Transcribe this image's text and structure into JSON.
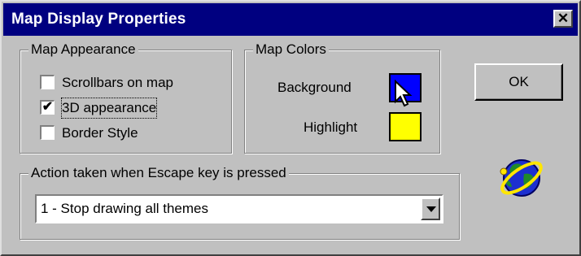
{
  "dialog": {
    "title": "Map Display Properties",
    "close_glyph": "✕",
    "close_icon": "close-icon",
    "title_bar_color": "#000080",
    "face_color": "#c0c0c0"
  },
  "map_appearance": {
    "legend": "Map Appearance",
    "options": [
      {
        "label": "Scrollbars on map",
        "checked": false,
        "mark": ""
      },
      {
        "label": "3D appearance",
        "checked": true,
        "mark": "✔"
      },
      {
        "label": "Border Style",
        "checked": false,
        "mark": ""
      }
    ]
  },
  "map_colors": {
    "legend": "Map Colors",
    "background": {
      "label": "Background",
      "color": "#0000ff"
    },
    "highlight": {
      "label": "Highlight",
      "color": "#ffff00"
    },
    "cursor_icon": "arrow-cursor-icon"
  },
  "ok_button": {
    "label": "OK"
  },
  "escape_action": {
    "legend": "Action taken when Escape key is pressed",
    "selected": "1 - Stop drawing all themes",
    "dropdown_icon": "chevron-down-icon"
  },
  "logo_icon": "globe-icon"
}
